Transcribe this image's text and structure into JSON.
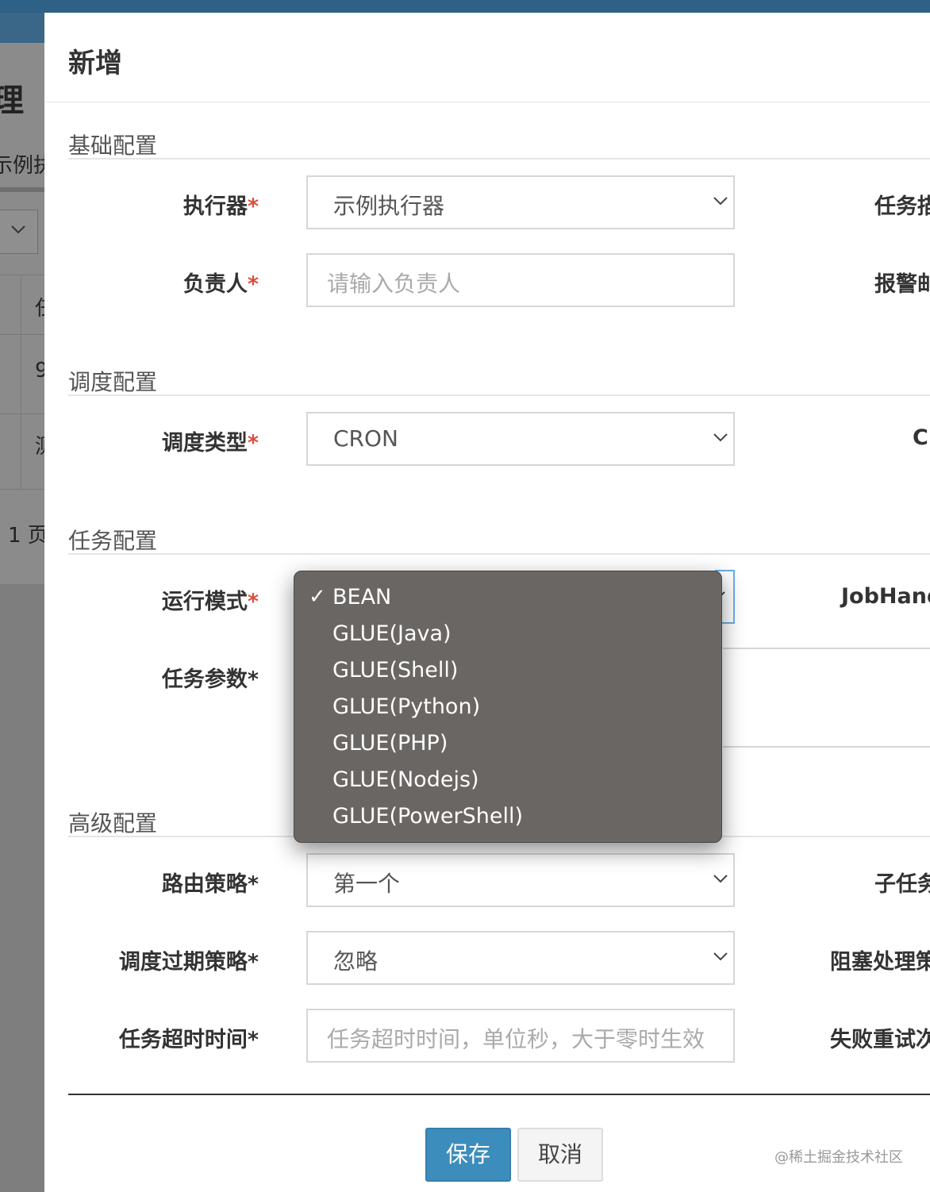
{
  "background": {
    "title_fragment": "理",
    "executor_fragment": "示例执",
    "row_fragments": [
      "任",
      "9",
      "测"
    ],
    "pager_fragment": "1 页"
  },
  "modal": {
    "title": "新增",
    "sections": {
      "basic": "基础配置",
      "schedule": "调度配置",
      "task": "任务配置",
      "advanced": "高级配置"
    },
    "fields": {
      "executor": {
        "label": "执行器",
        "value": "示例执行器"
      },
      "owner": {
        "label": "负责人",
        "placeholder": "请输入负责人"
      },
      "schedule_type": {
        "label": "调度类型",
        "value": "CRON"
      },
      "run_mode": {
        "label": "运行模式",
        "value": "BEAN"
      },
      "task_param": {
        "label": "任务参数*"
      },
      "route_strategy": {
        "label": "路由策略*",
        "value": "第一个"
      },
      "misfire_strategy": {
        "label": "调度过期策略*",
        "value": "忽略"
      },
      "timeout": {
        "label": "任务超时时间*",
        "placeholder": "任务超时时间，单位秒，大于零时生效"
      }
    },
    "required_mark": "*",
    "right_labels": {
      "task_desc": "任务描",
      "alarm_email": "报警邮",
      "cron": "C",
      "job_handler": "JobHand",
      "child_task": "子任务",
      "block_strategy": "阻塞处理策",
      "fail_retry": "失败重试次"
    },
    "buttons": {
      "save": "保存",
      "cancel": "取消"
    },
    "watermark": "@稀土掘金技术社区"
  },
  "run_mode_dropdown": {
    "selected": "BEAN",
    "check_mark": "✓",
    "options": [
      "BEAN",
      "GLUE(Java)",
      "GLUE(Shell)",
      "GLUE(Python)",
      "GLUE(PHP)",
      "GLUE(Nodejs)",
      "GLUE(PowerShell)"
    ]
  },
  "colors": {
    "primary": "#3c8dbc",
    "required": "#dd4b39",
    "focus_border": "#66afe9",
    "dropdown_bg": "#6a6663"
  }
}
